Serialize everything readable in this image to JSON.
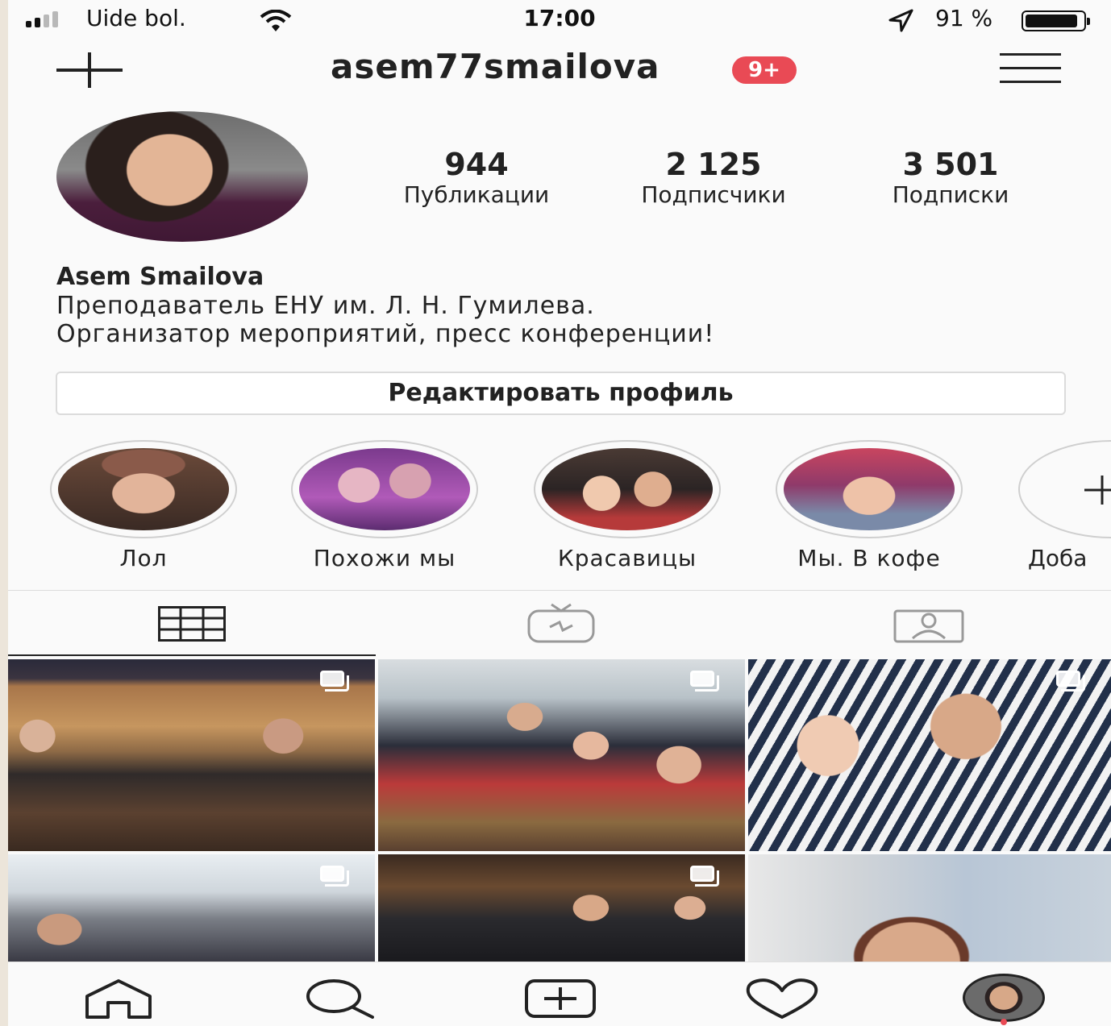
{
  "status_bar": {
    "carrier": "Uide bol.",
    "time": "17:00",
    "battery_text": "91 %",
    "battery_level": 0.91,
    "signal_bars_active": 2,
    "icons": [
      "signal-icon",
      "wifi-icon",
      "location-arrow-icon",
      "battery-icon"
    ]
  },
  "header": {
    "username": "asem77smailova",
    "notification_badge": "9+",
    "badge_color": "#e94a55",
    "icons": [
      "new-post-plus-icon",
      "hamburger-menu-icon"
    ]
  },
  "profile": {
    "stats": [
      {
        "value": "944",
        "label": "Публикации"
      },
      {
        "value": "2 125",
        "label": "Подписчики"
      },
      {
        "value": "3 501",
        "label": "Подписки"
      }
    ],
    "full_name": "Asem Smailova",
    "bio_line_1": "Преподаватель ЕНУ им. Л. Н. Гумилева.",
    "bio_line_2": "Организатор мероприятий, пресс конференции!",
    "edit_button": "Редактировать профиль"
  },
  "highlights": [
    {
      "label": "Лол"
    },
    {
      "label": "Похожи мы"
    },
    {
      "label": "Красавицы"
    },
    {
      "label": "Мы. В  кофе"
    }
  ],
  "add_highlight_label": "Доба",
  "tabs": [
    {
      "icon": "grid-icon",
      "active": true
    },
    {
      "icon": "igtv-icon",
      "active": false
    },
    {
      "icon": "tagged-user-icon",
      "active": false
    }
  ],
  "posts_count_visible": 6,
  "bottom_nav": [
    "home-icon",
    "search-icon",
    "add-post-icon",
    "heart-icon",
    "profile-avatar"
  ]
}
